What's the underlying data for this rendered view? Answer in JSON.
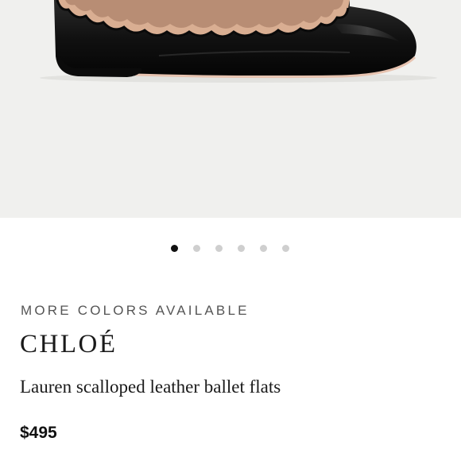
{
  "gallery": {
    "image_alt": "black leather ballet flat with scalloped edge",
    "dot_count": 6,
    "active_index": 0
  },
  "product": {
    "availability_label": "MORE COLORS AVAILABLE",
    "brand": "CHLOÉ",
    "name": "Lauren scalloped leather ballet flats",
    "price": "$495"
  },
  "colors": {
    "hero_background": "#f0f0ee",
    "shoe_leather": "#141414",
    "scallop_lining": "#d9ae92",
    "dot_active": "#111111",
    "dot_inactive": "#cfcfcf"
  }
}
